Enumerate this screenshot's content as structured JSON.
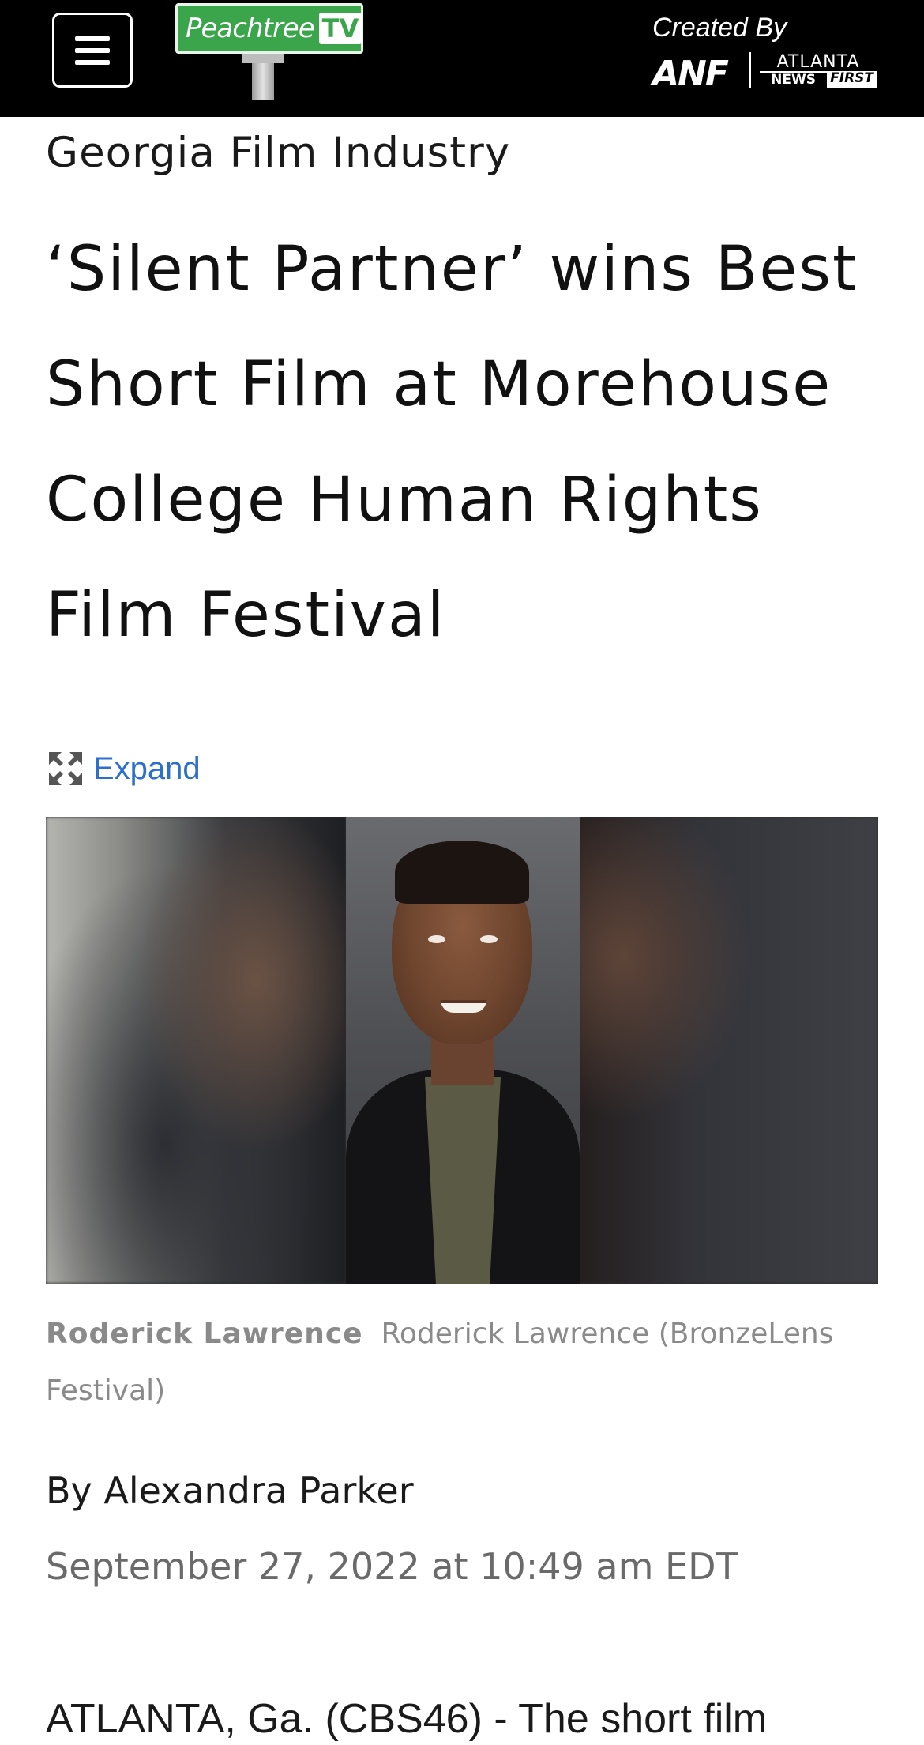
{
  "header": {
    "menu_label": "Menu",
    "logo": {
      "name": "Peachtree",
      "tv": "TV"
    },
    "created_by": "Created By",
    "partner": {
      "anf": "ANF",
      "atlanta": "ATLANTA",
      "news": "NEWS",
      "first": "FIRST"
    }
  },
  "article": {
    "section": "Georgia Film Industry",
    "headline": "‘Silent Partner’ wins Best Short Film at Morehouse College Human Rights Film Festival",
    "expand_label": "Expand",
    "image_alt": "Roderick Lawrence",
    "caption_name": "Roderick Lawrence",
    "caption_text": "Roderick Lawrence (BronzeLens Festival)",
    "byline": "By Alexandra Parker",
    "date": "September 27, 2022 at 10:49 am EDT",
    "body_first_line": "ATLANTA, Ga. (CBS46) - The short film"
  },
  "colors": {
    "header_bg": "#000000",
    "logo_green": "#3aa54a",
    "link_blue": "#2d6fcf",
    "caption_gray": "#8a8a8a"
  },
  "icons": {
    "menu": "hamburger-icon",
    "expand": "expand-arrows-icon"
  }
}
